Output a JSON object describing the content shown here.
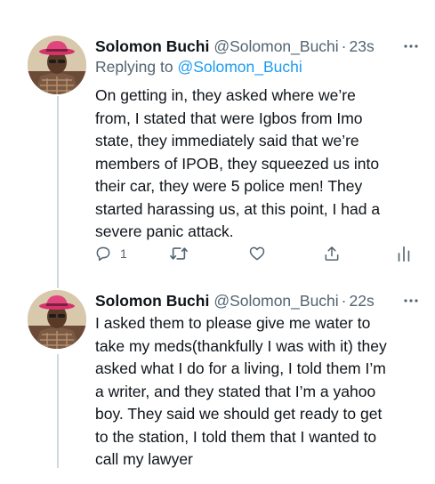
{
  "tweets": [
    {
      "author_name": "Solomon Buchi",
      "handle": "@Solomon_Buchi",
      "separator": "·",
      "time": "23s",
      "replying_prefix": "Replying to",
      "replying_to": "@Solomon_Buchi",
      "text_lines": [
        "On getting in, they asked where we’re",
        "from, I stated that were Igbos from Imo",
        "state, they immediately said that we’re",
        "members of IPOB, they squeezed us into",
        "their car, they were 5 police men! They",
        "started harassing us, at this point, I had a",
        "severe panic attack."
      ],
      "reply_count": "1"
    },
    {
      "author_name": "Solomon Buchi",
      "handle": "@Solomon_Buchi",
      "separator": "·",
      "time": "22s",
      "text_lines": [
        "I asked them to please give me water to",
        "take my meds(thankfully I was with it) they",
        "asked what I do for a living, I told them I’m",
        "a writer, and they stated that I’m a yahoo",
        "boy. They said we should get ready to get",
        "to the station, I told them that I wanted to",
        "call my lawyer"
      ]
    }
  ],
  "icons": {
    "more": "more-horizontal-icon",
    "reply": "reply-bubble-icon",
    "retweet": "retweet-icon",
    "like": "heart-icon",
    "share": "share-upload-icon",
    "analytics": "analytics-bars-icon"
  },
  "colors": {
    "text": "#0f1419",
    "secondary": "#536471",
    "link": "#1d9bf0",
    "thread_line": "#cfd9de"
  }
}
